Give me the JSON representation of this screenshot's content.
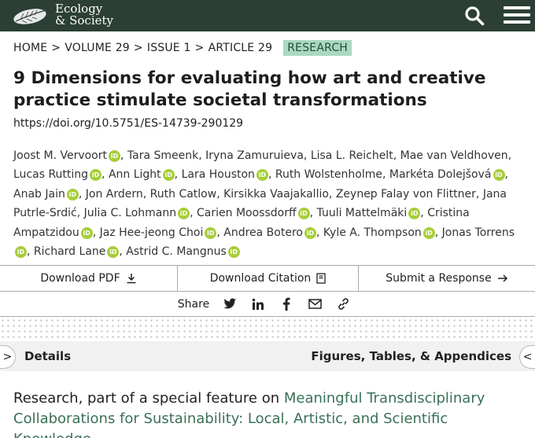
{
  "header": {
    "logo_line1": "Ecology",
    "logo_line2": "& Society",
    "search_icon": "search-icon",
    "menu_icon": "hamburger-menu-icon",
    "background": "#2b3f35"
  },
  "breadcrumb": {
    "items": [
      "HOME",
      "VOLUME 29",
      "ISSUE 1",
      "ARTICLE 29"
    ],
    "separator": ">",
    "badge": "RESEARCH",
    "badge_color": "#a9d9c2"
  },
  "article": {
    "title": "9 Dimensions for evaluating how art and creative practice stimulate societal transformations",
    "doi": "https://doi.org/10.5751/ES-14739-290129"
  },
  "authors": [
    {
      "name": "Joost M. Vervoort",
      "orcid": true
    },
    {
      "name": "Tara Smeenk",
      "orcid": false
    },
    {
      "name": "Iryna Zamuruieva",
      "orcid": false
    },
    {
      "name": "Lisa L. Reichelt",
      "orcid": false
    },
    {
      "name": "Mae van Veldhoven",
      "orcid": false
    },
    {
      "name": "Lucas Rutting",
      "orcid": true
    },
    {
      "name": "Ann Light",
      "orcid": true
    },
    {
      "name": "Lara Houston",
      "orcid": true
    },
    {
      "name": "Ruth Wolstenholme",
      "orcid": false
    },
    {
      "name": "Markéta Dolejšová",
      "orcid": true
    },
    {
      "name": "Anab Jain",
      "orcid": true
    },
    {
      "name": "Jon Ardern",
      "orcid": false
    },
    {
      "name": "Ruth Catlow",
      "orcid": false
    },
    {
      "name": "Kirsikka Vaajakallio",
      "orcid": false
    },
    {
      "name": "Zeynep Falay von Flittner",
      "orcid": false
    },
    {
      "name": "Jana Putrle-Srdić",
      "orcid": false
    },
    {
      "name": "Julia C. Lohmann",
      "orcid": true
    },
    {
      "name": "Carien Moossdorff",
      "orcid": true
    },
    {
      "name": "Tuuli Mattelmäki",
      "orcid": true
    },
    {
      "name": "Cristina Ampatzidou",
      "orcid": true
    },
    {
      "name": "Jaz Hee-jeong Choi",
      "orcid": true
    },
    {
      "name": "Andrea Botero",
      "orcid": true
    },
    {
      "name": "Kyle A. Thompson",
      "orcid": true
    },
    {
      "name": "Jonas Torrens",
      "orcid": true
    },
    {
      "name": "Richard Lane",
      "orcid": true
    },
    {
      "name": "Astrid C. Mangnus",
      "orcid": true
    }
  ],
  "orcid_badge": "iD",
  "orcid_color": "#a6ce39",
  "actions": {
    "download_pdf": "Download PDF",
    "download_citation": "Download Citation",
    "submit_response": "Submit a Response"
  },
  "share": {
    "label": "Share",
    "icons": [
      "twitter-icon",
      "linkedin-icon",
      "facebook-icon",
      "email-icon",
      "link-icon"
    ]
  },
  "tabs": {
    "left_arrow": ">",
    "details": "Details",
    "figures": "Figures, Tables, & Appendices",
    "right_arrow": "<"
  },
  "feature": {
    "prefix": "Research, part of a special feature on ",
    "link": "Meaningful Transdisciplinary Collaborations for Sustainability: Local, Artistic, and Scientific Knowledge",
    "link_color": "#3a7058"
  }
}
